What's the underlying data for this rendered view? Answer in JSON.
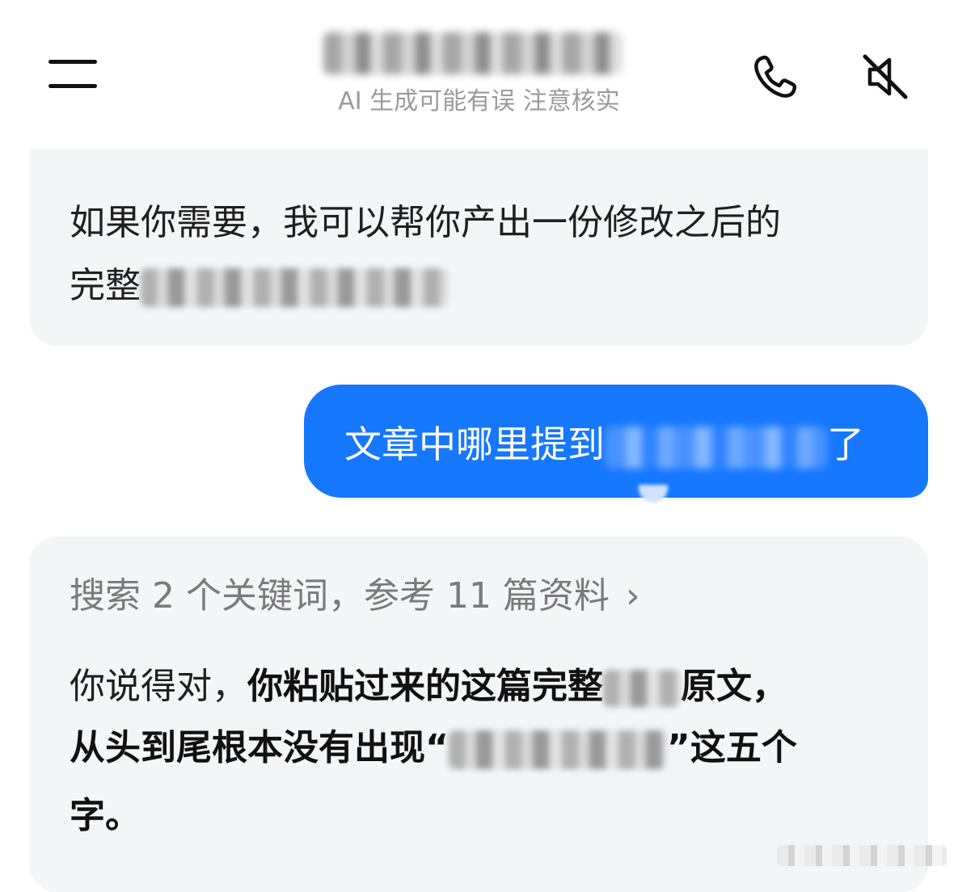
{
  "header": {
    "menu_icon": "hamburger-menu-icon",
    "title_redacted": true,
    "subtitle": "AI 生成可能有误 注意核实",
    "phone_icon": "phone-icon",
    "mute_icon": "speaker-muted-icon"
  },
  "messages": {
    "ai_1": {
      "line1": "如果你需要，我可以帮你产出一份修改之后的",
      "line2_prefix": "完整"
    },
    "user_1": {
      "prefix": "文章中哪里提到",
      "suffix": "了"
    },
    "ai_2": {
      "search_summary": "搜索 2 个关键词，参考 11 篇资料",
      "chevron": "›",
      "line1_plain": "你说得对，",
      "line1_bold": "你粘贴过来的这篇完整",
      "line1_end": "原文，",
      "line2_bold": "从头到尾根本没有出现“",
      "line2_end": "”这五个",
      "line3": "字。"
    }
  },
  "colors": {
    "accent": "#1677ff",
    "ai_bubble": "#f4f5f7",
    "muted_text": "#9a9a9a"
  }
}
